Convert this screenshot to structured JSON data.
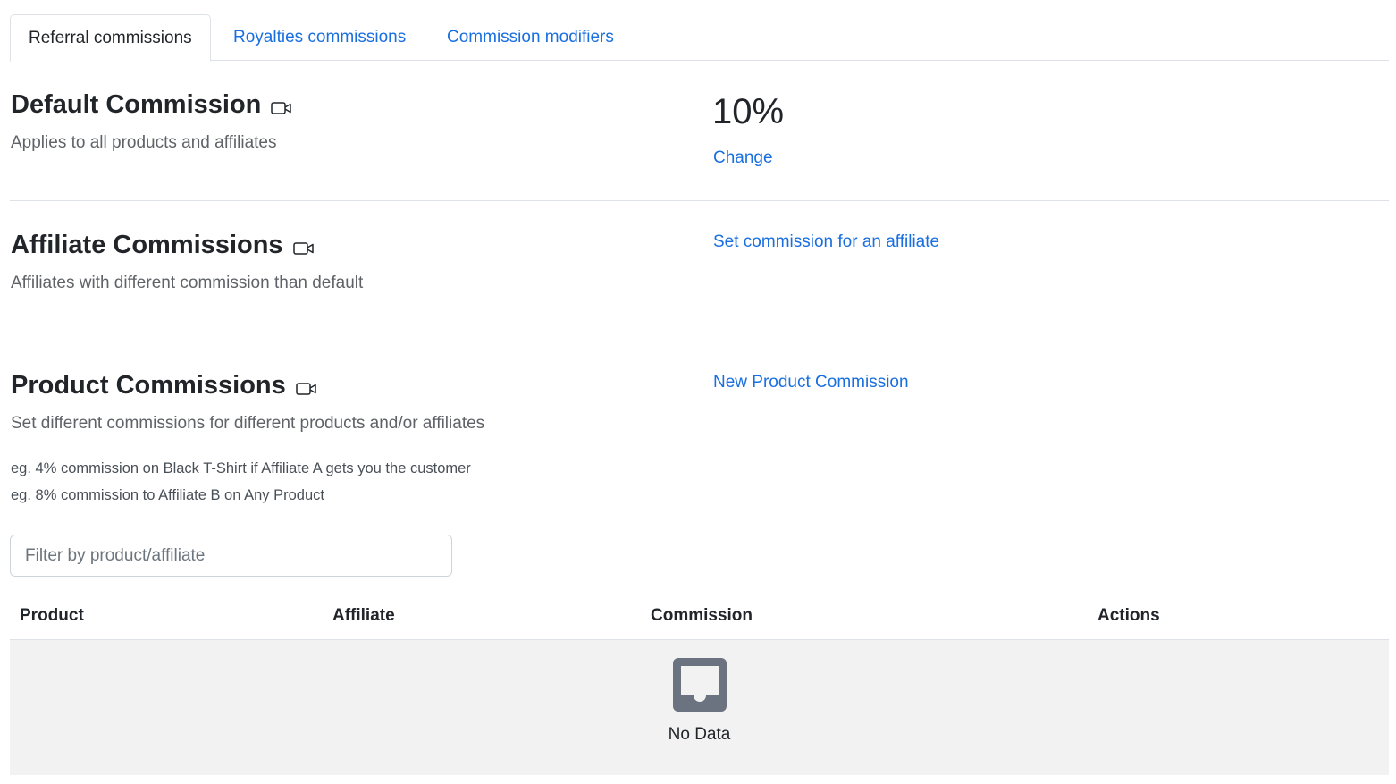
{
  "tabs": [
    {
      "label": "Referral commissions",
      "active": true
    },
    {
      "label": "Royalties commissions",
      "active": false
    },
    {
      "label": "Commission modifiers",
      "active": false
    }
  ],
  "default_commission": {
    "title": "Default Commission",
    "description": "Applies to all products and affiliates",
    "value": "10%",
    "change_label": "Change",
    "icon": "video-camera-icon"
  },
  "affiliate_commissions": {
    "title": "Affiliate Commissions",
    "description": "Affiliates with different commission than default",
    "action_label": "Set commission for an affiliate",
    "icon": "video-camera-icon"
  },
  "product_commissions": {
    "title": "Product Commissions",
    "description": "Set different commissions for different products and/or affiliates",
    "examples": [
      "eg. 4% commission on Black T-Shirt if Affiliate A gets you the customer",
      "eg. 8% commission to Affiliate B on Any Product"
    ],
    "action_label": "New Product Commission",
    "filter_placeholder": "Filter by product/affiliate",
    "icon": "video-camera-icon"
  },
  "table": {
    "columns": [
      "Product",
      "Affiliate",
      "Commission",
      "Actions"
    ],
    "empty_text": "No Data",
    "empty_icon": "inbox-icon"
  },
  "colors": {
    "link": "#1a6fe0",
    "text": "#212529",
    "muted": "#5f6368",
    "border": "#dee2e6",
    "empty_bg": "#f2f2f2",
    "empty_icon": "#6b7280"
  }
}
